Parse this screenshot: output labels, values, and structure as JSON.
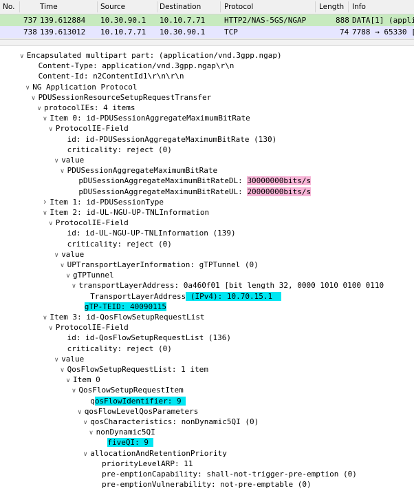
{
  "packet_list": {
    "columns": [
      "No.",
      "Time",
      "Source",
      "Destination",
      "Protocol",
      "Length",
      "Info"
    ],
    "rows": [
      {
        "no": "737",
        "time": "139.612884",
        "src": "10.30.90.1",
        "dst": "10.10.7.71",
        "proto": "HTTP2/NAS-5GS/NGAP",
        "len": "888",
        "info": "DATA[1] (applic"
      },
      {
        "no": "738",
        "time": "139.613012",
        "src": "10.10.7.71",
        "dst": "10.30.90.1",
        "proto": "TCP",
        "len": "74",
        "info": "7788 → 65330 ["
      }
    ]
  },
  "colors": {
    "row_selected": "#c7eabf",
    "row_tcp": "#e6e6ff",
    "highlight_pink": "#f7b6d7",
    "highlight_cyan": "#00e6f2"
  },
  "tree": [
    {
      "t": "Encapsulated multipart part:  (application/vnd.3gpp.ngap)",
      "tw": "open",
      "ind": 2
    },
    {
      "t": "Content-Type: application/vnd.3gpp.ngap\\r\\n",
      "ind": 4
    },
    {
      "t": "Content-Id: n2ContentId1\\r\\n\\r\\n",
      "ind": 4
    },
    {
      "t": "NG Application Protocol",
      "tw": "open",
      "ind": 3
    },
    {
      "t": "PDUSessionResourceSetupRequestTransfer",
      "tw": "open",
      "ind": 4
    },
    {
      "t": "protocolIEs: 4 items",
      "tw": "open",
      "ind": 5
    },
    {
      "t": "Item 0: id-PDUSessionAggregateMaximumBitRate",
      "tw": "open",
      "ind": 6
    },
    {
      "t": "ProtocolIE-Field",
      "tw": "open",
      "ind": 7
    },
    {
      "t": "id: id-PDUSessionAggregateMaximumBitRate (130)",
      "ind": 9
    },
    {
      "t": "criticality: reject (0)",
      "ind": 9
    },
    {
      "t": "value",
      "tw": "open",
      "ind": 8
    },
    {
      "t": "PDUSessionAggregateMaximumBitRate",
      "tw": "open",
      "ind": 9
    },
    {
      "t": "pDUSessionAggregateMaximumBitRateDL: ",
      "hl": "30000000bits/s",
      "hlc": "pink",
      "ind": 11
    },
    {
      "t": "pDUSessionAggregateMaximumBitRateUL: ",
      "hl": "20000000bits/s",
      "hlc": "pink",
      "ind": 11
    },
    {
      "t": "Item 1: id-PDUSessionType",
      "tw": "closed",
      "ind": 6
    },
    {
      "t": "Item 2: id-UL-NGU-UP-TNLInformation",
      "tw": "open",
      "ind": 6
    },
    {
      "t": "ProtocolIE-Field",
      "tw": "open",
      "ind": 7
    },
    {
      "t": "id: id-UL-NGU-UP-TNLInformation (139)",
      "ind": 9
    },
    {
      "t": "criticality: reject (0)",
      "ind": 9
    },
    {
      "t": "value",
      "tw": "open",
      "ind": 8
    },
    {
      "t": "UPTransportLayerInformation: gTPTunnel (0)",
      "tw": "open",
      "ind": 9
    },
    {
      "t": "gTPTunnel",
      "tw": "open",
      "ind": 10
    },
    {
      "t": "transportLayerAddress: 0a460f01 [bit length 32, 0000 1010  0100 0110",
      "tw": "open",
      "ind": 11
    },
    {
      "t": "TransportLayerAddress",
      "hl": " (IPv4): 10.70.15.1  ",
      "hlc": "cyan",
      "ind": 13
    },
    {
      "t": "",
      "hl": "gTP-TEID: 40090115",
      "hlc": "cyan",
      "ind": 12
    },
    {
      "t": "Item 3: id-QosFlowSetupRequestList",
      "tw": "open",
      "ind": 6
    },
    {
      "t": "ProtocolIE-Field",
      "tw": "open",
      "ind": 7
    },
    {
      "t": "id: id-QosFlowSetupRequestList (136)",
      "ind": 9
    },
    {
      "t": "criticality: reject (0)",
      "ind": 9
    },
    {
      "t": "value",
      "tw": "open",
      "ind": 8
    },
    {
      "t": "QosFlowSetupRequestList: 1 item",
      "tw": "open",
      "ind": 9
    },
    {
      "t": "Item 0",
      "tw": "open",
      "ind": 10
    },
    {
      "t": "QosFlowSetupRequestItem",
      "tw": "open",
      "ind": 11
    },
    {
      "t": "q",
      "hl": "osFlowIdentifier: 9 ",
      "hlc": "cyan",
      "ind": 13
    },
    {
      "t": "qosFlowLevelQosParameters",
      "tw": "open",
      "ind": 12
    },
    {
      "t": "qosCharacteristics: nonDynamic5QI (0)",
      "tw": "open",
      "ind": 13
    },
    {
      "t": "nonDynamic5QI",
      "tw": "open",
      "ind": 14
    },
    {
      "t": "",
      "hl": "fiveQI: 9 ",
      "hlc": "cyan",
      "ind": 16
    },
    {
      "t": "allocationAndRetentionPriority",
      "tw": "open",
      "ind": 13
    },
    {
      "t": "priorityLevelARP: 11",
      "ind": 15
    },
    {
      "t": "pre-emptionCapability: shall-not-trigger-pre-emption (0)",
      "ind": 15
    },
    {
      "t": "pre-emptionVulnerability: not-pre-emptable (0)",
      "ind": 15
    }
  ]
}
